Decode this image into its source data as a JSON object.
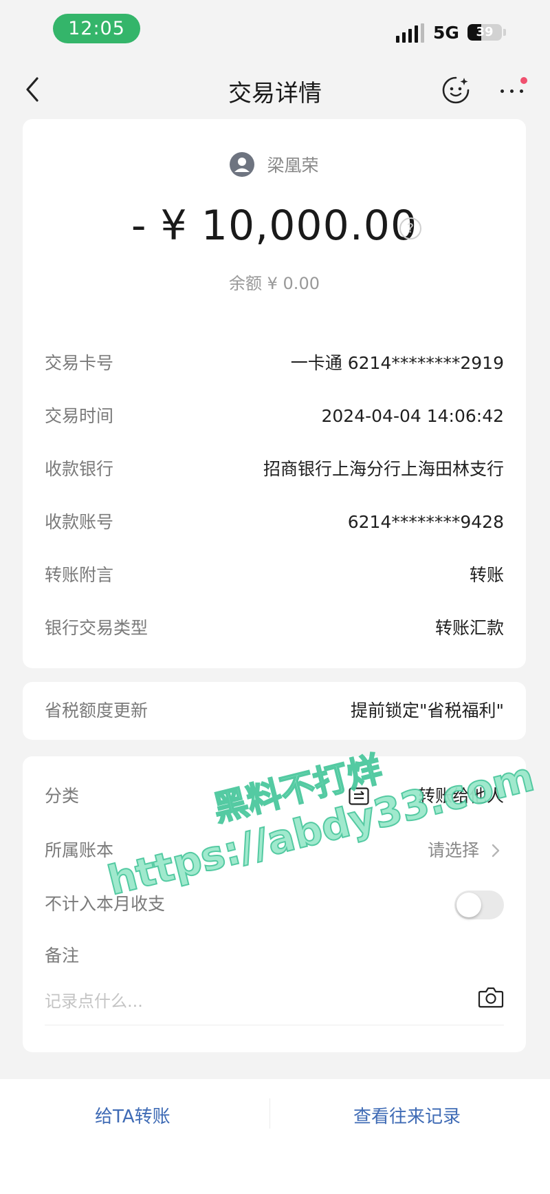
{
  "status_bar": {
    "time": "12:05",
    "network": "5G",
    "battery": "39",
    "battery_level": 0.39
  },
  "nav": {
    "title": "交易详情"
  },
  "summary": {
    "payee_name": "梁凰荣",
    "amount": "- ¥ 10,000.00",
    "balance": "余额 ¥ 0.00"
  },
  "details": [
    {
      "label": "交易卡号",
      "value": "一卡通 6214********2919"
    },
    {
      "label": "交易时间",
      "value": "2024-04-04 14:06:42"
    },
    {
      "label": "收款银行",
      "value": "招商银行上海分行上海田林支行"
    },
    {
      "label": "收款账号",
      "value": "6214********9428"
    },
    {
      "label": "转账附言",
      "value": "转账"
    },
    {
      "label": "银行交易类型",
      "value": "转账汇款"
    }
  ],
  "tax": {
    "label": "省税额度更新",
    "value": "提前锁定\"省税福利\""
  },
  "meta": {
    "category_label": "分类",
    "category_value": "转账给他人",
    "ledger_label": "所属账本",
    "ledger_value": "请选择",
    "exclude_label": "不计入本月收支",
    "exclude_on": false,
    "note_label": "备注",
    "note_placeholder": "记录点什么..."
  },
  "bottom": {
    "transfer_label": "给TA转账",
    "history_label": "查看往来记录"
  },
  "watermark": {
    "line1": "黑料不打烊",
    "line2": "https://abdy33.com"
  },
  "colors": {
    "status_pill": "#34b56a",
    "link_blue": "#3f6bb5",
    "badge_red": "#f0506e",
    "watermark_green": "#98e8c9"
  }
}
